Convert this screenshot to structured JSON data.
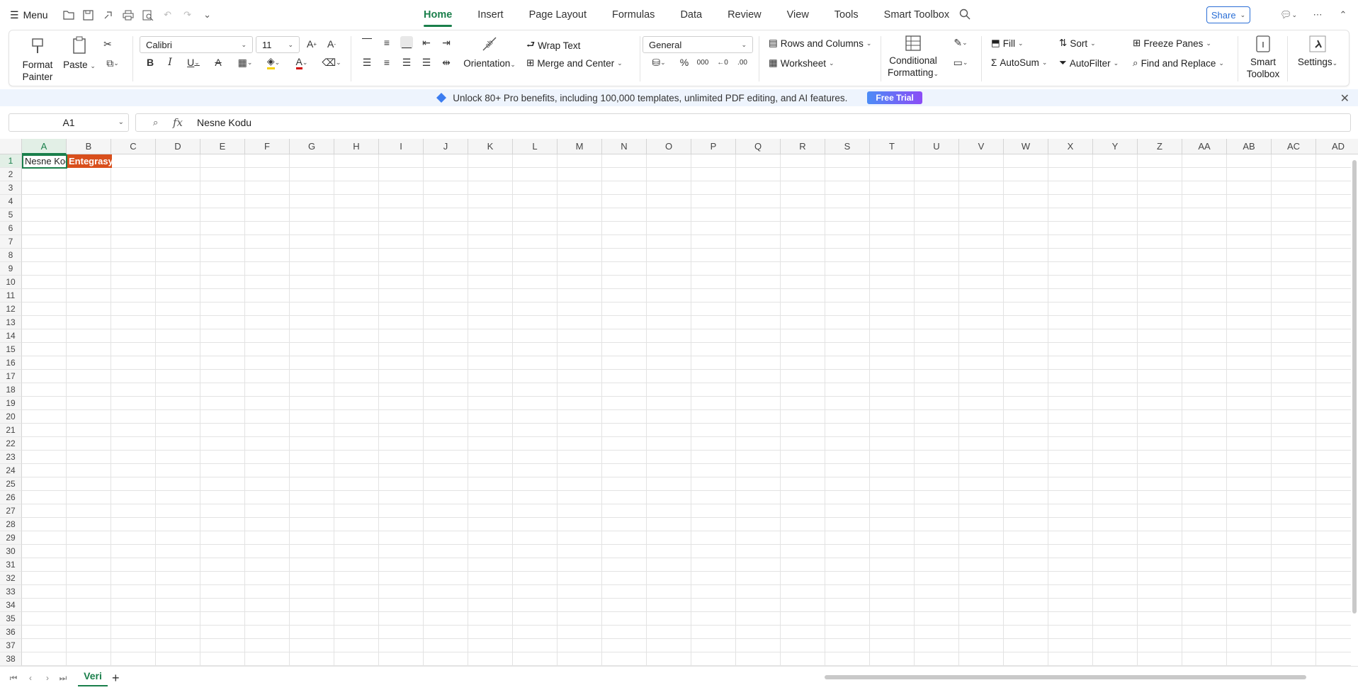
{
  "topbar": {
    "menu_label": "Menu",
    "tabs": [
      "Home",
      "Insert",
      "Page Layout",
      "Formulas",
      "Data",
      "Review",
      "View",
      "Tools",
      "Smart Toolbox"
    ],
    "share_label": "Share"
  },
  "ribbon": {
    "format_painter": [
      "Format",
      "Painter"
    ],
    "paste": "Paste",
    "font_name": "Calibri",
    "font_size": "11",
    "wrap_text": "Wrap Text",
    "orientation": "Orientation",
    "merge_center": "Merge and Center",
    "number_format": "General",
    "rows_columns": "Rows and Columns",
    "worksheet": "Worksheet",
    "conditional_formatting": [
      "Conditional",
      "Formatting"
    ],
    "fill": "Fill",
    "sort": "Sort",
    "freeze_panes": "Freeze Panes",
    "autosum": "AutoSum",
    "autofilter": "AutoFilter",
    "find_replace": "Find and Replace",
    "smart_toolbox": [
      "Smart",
      "Toolbox"
    ],
    "settings": "Settings",
    "underline_glyph": "U",
    "font_color_glyph": "A",
    "percent_glyph": "%",
    "thousands_glyph": "000",
    "decrease_decimal_glyph": "←0",
    "increase_decimal_glyph": ".00",
    "sigma_glyph": "Σ"
  },
  "banner": {
    "text": "Unlock 80+ Pro benefits, including 100,000 templates, unlimited PDF editing, and AI features.",
    "cta": "Free Trial"
  },
  "formula_bar": {
    "name_box": "A1",
    "fx_label": "fx",
    "value": "Nesne Kodu"
  },
  "sheet": {
    "columns": [
      "A",
      "B",
      "C",
      "D",
      "E",
      "F",
      "G",
      "H",
      "I",
      "J",
      "K",
      "L",
      "M",
      "N",
      "O",
      "P",
      "Q",
      "R",
      "S",
      "T",
      "U",
      "V",
      "W",
      "X",
      "Y",
      "Z",
      "AA",
      "AB",
      "AC",
      "AD"
    ],
    "rows": [
      "1",
      "2",
      "3",
      "4",
      "5",
      "6",
      "7",
      "8",
      "9",
      "10",
      "11",
      "12",
      "13",
      "14",
      "15",
      "16",
      "17",
      "18",
      "19",
      "20",
      "21",
      "22",
      "23",
      "24",
      "25",
      "26",
      "27",
      "28",
      "29",
      "30",
      "31",
      "32",
      "33",
      "34",
      "35",
      "36",
      "37",
      "38"
    ],
    "selected_column": "A",
    "selected_row": "1",
    "cells": {
      "A1": "Nesne Kodu",
      "B1": "Entegrasy"
    },
    "b1_fill": "#d94f1c",
    "accent": "#1a7f4b"
  },
  "sheet_tabs": [
    "Veri"
  ]
}
